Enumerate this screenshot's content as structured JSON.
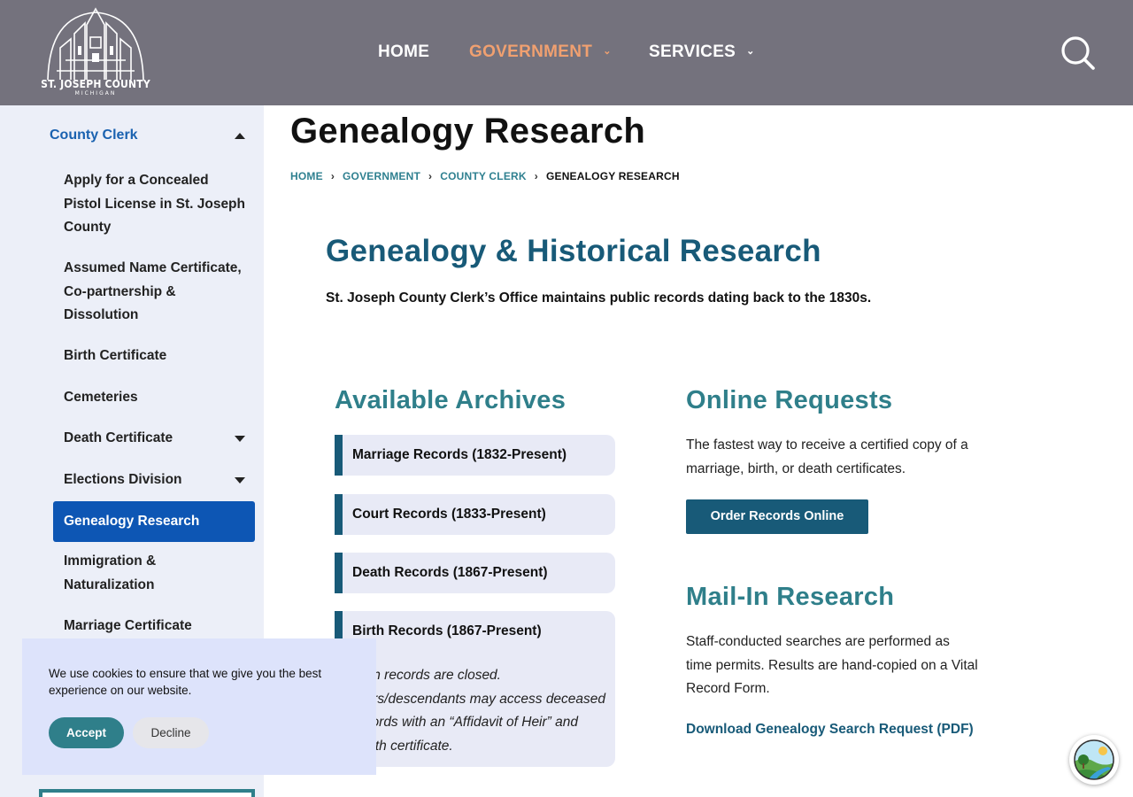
{
  "header": {
    "logo_text": "ST. JOSEPH COUNTY",
    "logo_sub": "MICHIGAN",
    "nav": [
      {
        "label": "HOME"
      },
      {
        "label": "GOVERNMENT"
      },
      {
        "label": "SERVICES"
      }
    ],
    "active_nav_color": "#f0a070"
  },
  "sidebar": {
    "heading": "County Clerk",
    "items": [
      {
        "label": "Apply for a Concealed Pistol License in St. Joseph County"
      },
      {
        "label": "Assumed Name Certificate, Co-partnership & Dissolution"
      },
      {
        "label": "Birth Certificate"
      },
      {
        "label": "Cemeteries"
      },
      {
        "label": "Death Certificate"
      },
      {
        "label": "Elections Division"
      },
      {
        "label": "Genealogy Research"
      },
      {
        "label": "Immigration & Naturalization"
      },
      {
        "label": "Marriage Certificate"
      }
    ]
  },
  "page": {
    "title": "Genealogy Research",
    "breadcrumb": [
      "HOME",
      "GOVERNMENT",
      "COUNTY CLERK",
      "GENEALOGY RESEARCH"
    ],
    "section_title": "Genealogy & Historical Research",
    "intro": "St. Joseph County Clerk’s Office maintains public records dating back to the 1830s."
  },
  "archives": {
    "heading": "Available Archives",
    "items": [
      {
        "title": "Marriage Records (1832-Present)"
      },
      {
        "title": "Court Records (1833-Present)"
      },
      {
        "title": "Death Records (1867-Present)"
      },
      {
        "title": "Birth Records (1867-Present)",
        "note": "Birth records are closed. Heirs/descendants may access deceased records with an “Affidavit of Heir” and death certificate."
      }
    ]
  },
  "online": {
    "heading": "Online Requests",
    "text": "The fastest way to receive a certified copy of a marriage, birth, or death certificates.",
    "button": "Order Records Online"
  },
  "mail": {
    "heading": "Mail-In Research",
    "text": "Staff-conducted searches are performed as time permits. Results are hand-copied on a Vital Record Form.",
    "link": "Download Genealogy Search Request (PDF)"
  },
  "cookie": {
    "text": "We use cookies to ensure that we give you the best experience on our website.",
    "accept": "Accept",
    "decline": "Decline"
  },
  "colors": {
    "header_bg": "#74727d",
    "sidebar_bg": "#eceff8",
    "active_item": "#0d56b4",
    "heading_dark": "#185a78",
    "heading_teal": "#2f7f8a"
  }
}
